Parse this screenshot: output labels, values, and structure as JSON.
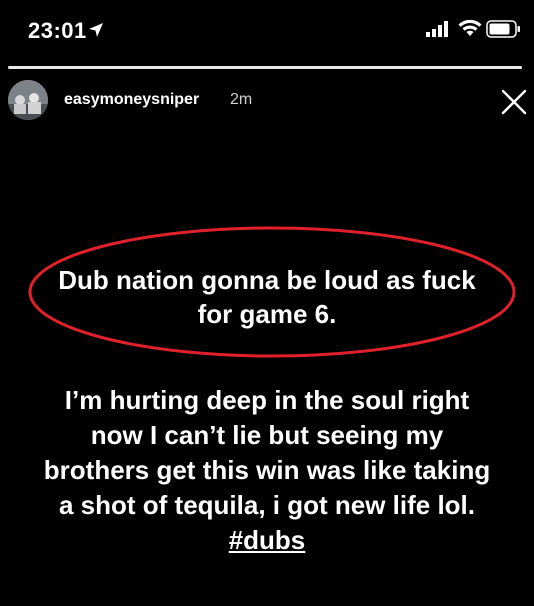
{
  "status_bar": {
    "time": "23:01",
    "icons": [
      "location-arrow-icon",
      "cellular-signal-icon",
      "wifi-icon",
      "battery-icon"
    ]
  },
  "story": {
    "progress": 1.0,
    "username": "easymoneysniper",
    "timestamp": "2m",
    "highlighted_line_1": "Dub nation gonna be loud as fuck",
    "highlighted_line_2": "for game 6.",
    "caption_lines": [
      "I’m hurting deep in the soul right",
      "now I can’t lie but seeing my",
      "brothers get this win was like taking",
      "a shot of tequila, i got new life lol."
    ],
    "hashtag": "#dubs"
  },
  "colors": {
    "background": "#000000",
    "text": "#ffffff",
    "highlight_circle": "#e0202a"
  }
}
